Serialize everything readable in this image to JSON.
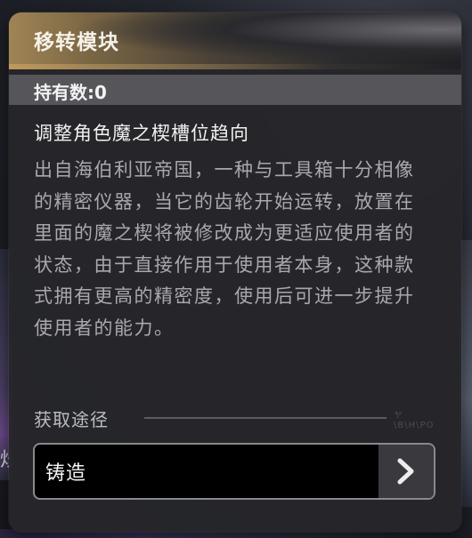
{
  "panel": {
    "title": "移转模块",
    "count_label": "持有数:0",
    "subtitle": "调整角色魔之楔槽位趋向",
    "description": "出自海伯利亚帝国，一种与工具箱十分相像的精密仪器，当它的齿轮开始运转，放置在里面的魔之楔将被修改成为更适应使用者的状态，由于直接作用于使用者本身，这种款式拥有更高的精密度，使用后可进一步提升使用者的能力。",
    "source": {
      "label": "获取途径",
      "mark": "ヤ\\B\\H\\PO",
      "button_label": "铸造",
      "button_icon": "chevron-right-icon"
    }
  },
  "background": {
    "left_glyph": "炒"
  },
  "colors": {
    "panel_bg": "#26262a",
    "header_gold": "#a08455",
    "count_bar": "#55555a",
    "description_text": "#a9a9ad",
    "button_bg": "#000000",
    "arrow_box": "#3a3a3e"
  }
}
